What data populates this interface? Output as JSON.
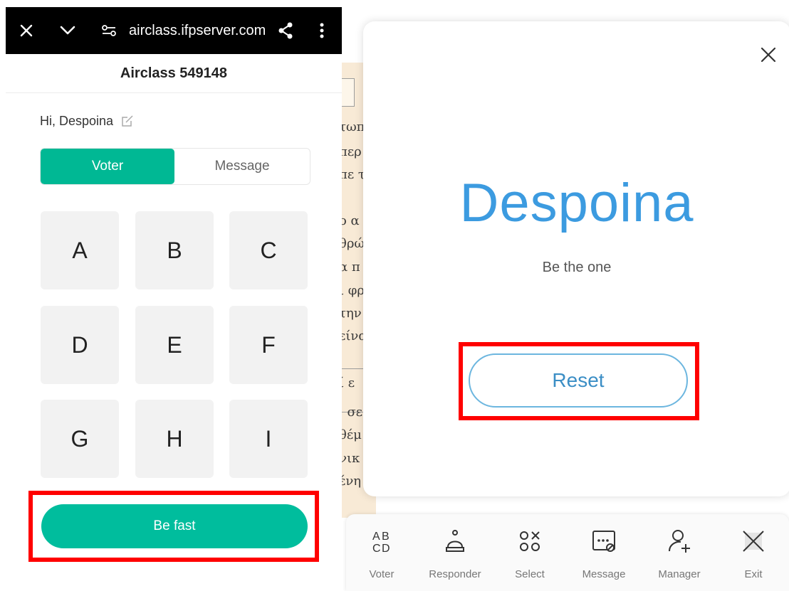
{
  "browser": {
    "url": "airclass.ifpserver.com",
    "icons": [
      "close-icon",
      "chevron-down-icon",
      "site-settings-icon",
      "share-icon",
      "more-vert-icon"
    ]
  },
  "page": {
    "title": "Airclass 549148"
  },
  "user": {
    "greeting": "Hi, Despoina"
  },
  "tabs": [
    {
      "label": "Voter",
      "active": true
    },
    {
      "label": "Message",
      "active": false
    }
  ],
  "options": [
    "A",
    "B",
    "C",
    "D",
    "E",
    "F",
    "G",
    "H",
    "I"
  ],
  "be_fast": {
    "label": "Be fast"
  },
  "doc_fragments": [
    "τωπ",
    "περ",
    "πε τ",
    "ο α",
    "θρώ",
    "α π",
    "ι φρ",
    "την",
    "είνα",
    "ί ε",
    ". σε",
    "θέμ",
    "νικ",
    "ένη"
  ],
  "card": {
    "winner": "Despoina",
    "subtitle": "Be the one",
    "reset_label": "Reset"
  },
  "toolbar": [
    {
      "label": "Voter",
      "icon": "abcd-icon"
    },
    {
      "label": "Responder",
      "icon": "bell-icon"
    },
    {
      "label": "Select",
      "icon": "select-shapes-icon"
    },
    {
      "label": "Message",
      "icon": "message-icon"
    },
    {
      "label": "Manager",
      "icon": "person-add-icon"
    },
    {
      "label": "Exit",
      "icon": "exit-icon"
    }
  ],
  "colors": {
    "accent": "#00b894",
    "highlight": "#ff0000",
    "winner": "#3c9be0",
    "reset_border": "#6cb6df"
  }
}
